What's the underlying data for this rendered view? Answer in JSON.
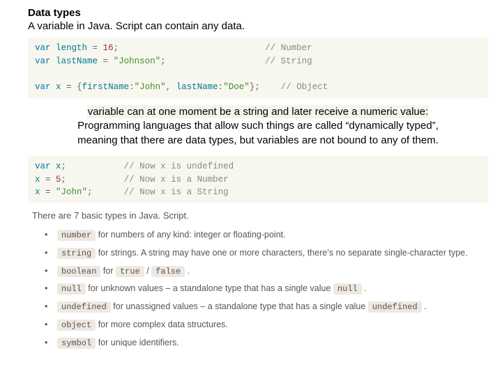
{
  "heading": "Data types",
  "subheading": "A variable in Java. Script can contain any data.",
  "code1": {
    "l1": {
      "kw": "var",
      "id": "length",
      "op": " = ",
      "val": "16",
      "end": ";",
      "cmt": "// Number"
    },
    "l2": {
      "kw": "var",
      "id": "lastName",
      "op": " = ",
      "val": "\"Johnson\"",
      "end": ";",
      "cmt": "// String"
    },
    "l3": {
      "kw": "var",
      "id": "x",
      "op": " = ",
      "ob": "{",
      "k1": "firstName",
      "c1": ":",
      "v1": "\"John\"",
      "cm": ",",
      "sp": " ",
      "k2": "lastName",
      "c2": ":",
      "v2": "\"Doe\"",
      "cb": "}",
      "end": ";",
      "cmt": "// Object"
    }
  },
  "para": {
    "hl": "variable can at one moment be a string and later receive a numeric value:",
    "rest1": "Programming languages that allow such things are called “dynamically typed”,",
    "rest2": "meaning that there are data types, but variables are not bound to any of them."
  },
  "code2": {
    "l1": {
      "kw": "var",
      "id": " x",
      "end": ";",
      "cmt": "// Now x is undefined"
    },
    "l2": {
      "id": "x",
      "op": " = ",
      "val": "5",
      "end": ";",
      "cmt": "// Now x is a Number"
    },
    "l3": {
      "id": "x",
      "op": " = ",
      "val": "\"John\"",
      "end": ";",
      "cmt": "// Now x is a String"
    }
  },
  "typesIntro": "There are 7 basic types in Java. Script.",
  "types": [
    {
      "chip": "number",
      "rest": " for numbers of any kind: integer or floating-point."
    },
    {
      "chip": "string",
      "rest": " for strings. A string may have one or more characters, there’s no separate single-character type."
    },
    {
      "chip": "boolean",
      "rest": " for ",
      "chip2": "true",
      "sep": " / ",
      "chip3": "false",
      "tail": " ."
    },
    {
      "chip": "null",
      "rest": " for unknown values – a standalone type that has a single value ",
      "chip2": "null",
      "tail": " ."
    },
    {
      "chip": "undefined",
      "rest": " for unassigned values – a standalone type that has a single value ",
      "chip2": "undefined",
      "tail": " ."
    },
    {
      "chip": "object",
      "rest": " for more complex data structures."
    },
    {
      "chip": "symbol",
      "rest": " for unique identifiers."
    }
  ]
}
